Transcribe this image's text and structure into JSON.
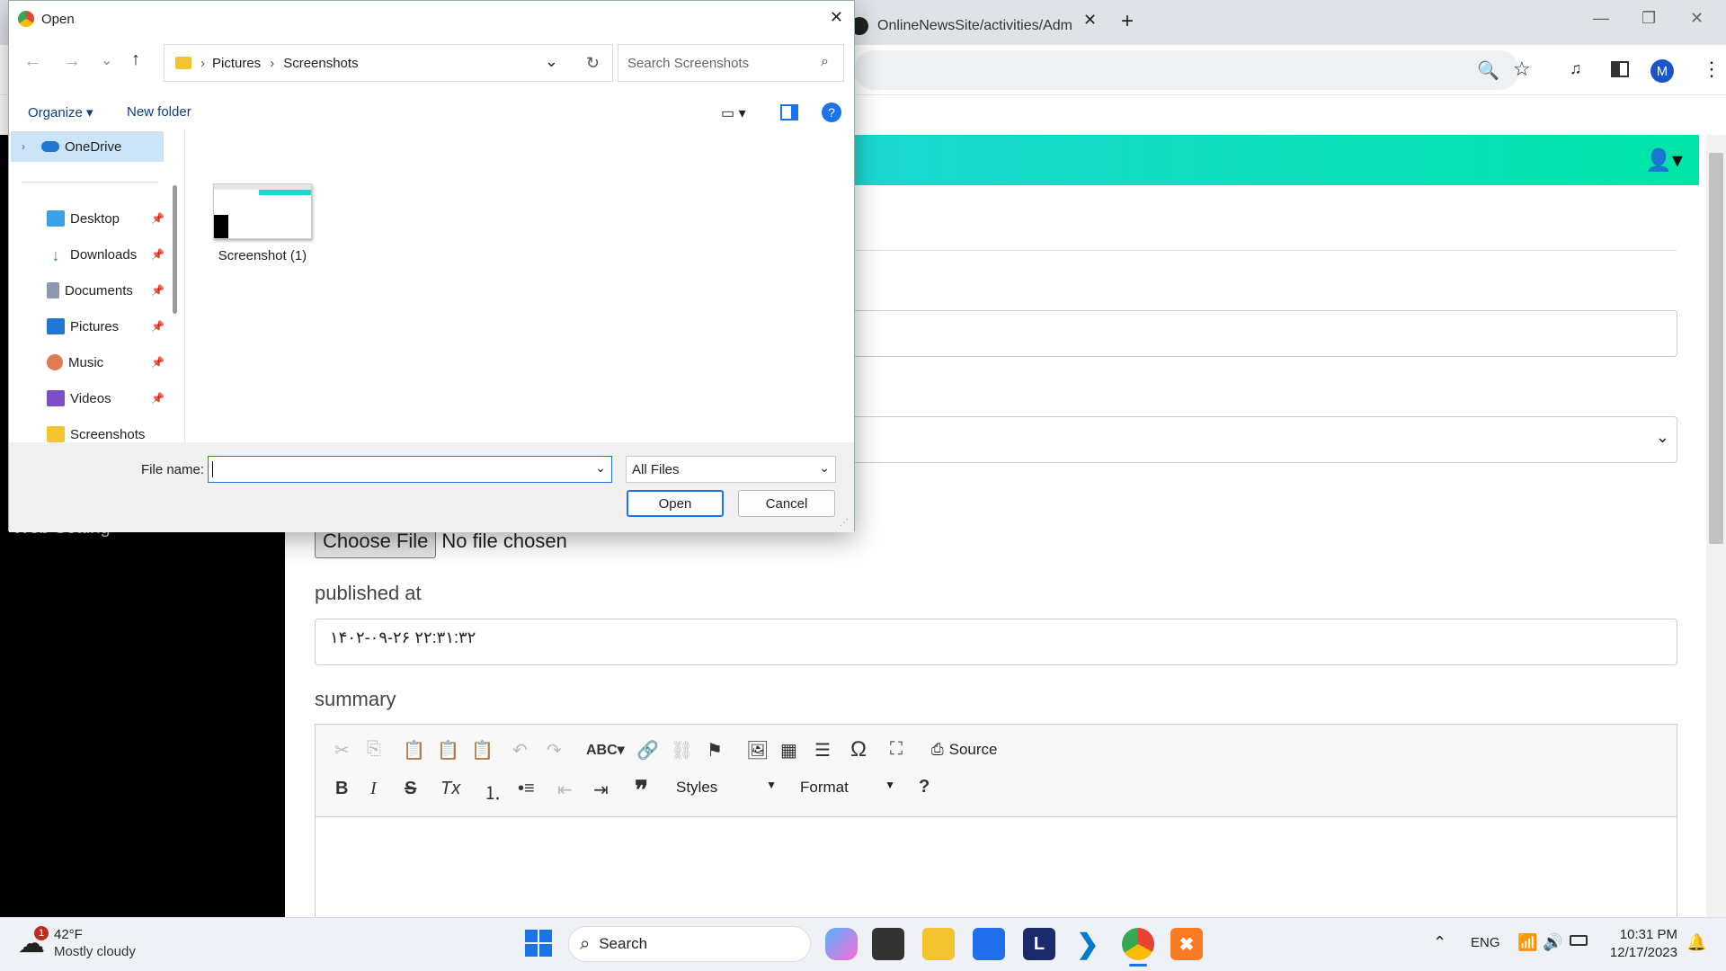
{
  "browser": {
    "tab_title": "OnlineNewsSite/activities/Adm",
    "window_controls": [
      "minimize",
      "maximize",
      "close"
    ],
    "profile_initial": "M"
  },
  "page": {
    "sidebar_item": "Web Setting",
    "choose_file_label": "Choose File",
    "no_file_text": "No file chosen",
    "published_label": "published at",
    "published_value": "۱۴۰۲-۰۹-۲۶ ۲۲:۳۱:۳۲",
    "summary_label": "summary",
    "editor": {
      "source_label": "Source",
      "styles_label": "Styles",
      "format_label": "Format"
    }
  },
  "dialog": {
    "title": "Open",
    "breadcrumb": [
      "Pictures",
      "Screenshots"
    ],
    "search_placeholder": "Search Screenshots",
    "organize": "Organize",
    "new_folder": "New folder",
    "nav_items": [
      "OneDrive",
      "Desktop",
      "Downloads",
      "Documents",
      "Pictures",
      "Music",
      "Videos",
      "Screenshots"
    ],
    "files": [
      {
        "name": "Screenshot (1)"
      }
    ],
    "filename_label": "File name:",
    "filename_value": "",
    "filetype": "All Files",
    "open_button": "Open",
    "cancel_button": "Cancel"
  },
  "taskbar": {
    "weather_temp": "42°F",
    "weather_desc": "Mostly cloudy",
    "weather_badge": "1",
    "search_label": "Search",
    "lang": "ENG",
    "time": "10:31 PM",
    "date": "12/17/2023",
    "pinned_letter": "L"
  }
}
